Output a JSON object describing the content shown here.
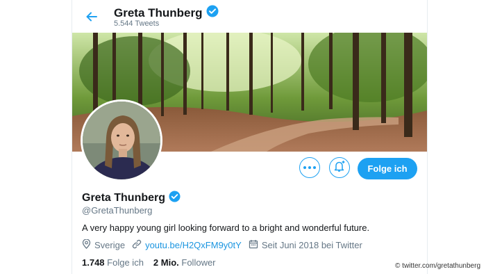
{
  "header": {
    "name": "Greta Thunberg",
    "tweet_count": "5.544 Tweets"
  },
  "actions": {
    "more_label": "More",
    "notify_label": "Turn on notifications",
    "follow_label": "Folge ich"
  },
  "profile": {
    "name": "Greta Thunberg",
    "handle": "@GretaThunberg",
    "bio": "A very happy young girl looking forward to a bright and wonderful future.",
    "location": "Sverige",
    "link": "youtu.be/H2QxFM9y0tY",
    "joined": "Seit Juni 2018 bei Twitter"
  },
  "stats": {
    "following_count": "1.748",
    "following_label": "Folge ich",
    "followers_count": "2 Mio.",
    "followers_label": "Follower"
  },
  "credit": "© twitter.com/gretathunberg",
  "colors": {
    "accent": "#1da1f2",
    "text": "#14171a",
    "muted": "#657786"
  }
}
